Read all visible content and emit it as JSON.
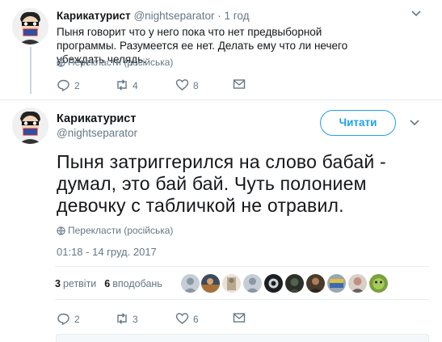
{
  "tweet_1": {
    "name": "Карикатурист",
    "handle": "@nightseparator",
    "dot": "·",
    "time": "1 год",
    "text": "Пыня говорит что у него пока что нет предвыборной программы. Разумеется ее нет. Делать ему что ли нечего убеждать челядь.",
    "translate": "Перекласти (російська)",
    "replies": "2",
    "retweets": "4",
    "likes": "8"
  },
  "tweet_2": {
    "name": "Карикатурист",
    "handle": "@nightseparator",
    "follow_label": "Читати",
    "text": "Пыня затриггерился на слово бабай - думал, это бай бай. Чуть полонием девочку с табличкой не отравил.",
    "translate": "Перекласти (російська)",
    "timestamp": "01:18 - 14 груд. 2017",
    "retweet_count": "3",
    "retweet_label": "ретвіти",
    "like_count": "6",
    "like_label": "вподобань",
    "replies": "2",
    "retweets": "3",
    "likes": "6"
  },
  "colors": {
    "accent": "#1da1f2",
    "muted": "#657786",
    "border": "#e6ecf0"
  },
  "icons": [
    "reply-icon",
    "retweet-icon",
    "heart-icon",
    "envelope-icon",
    "globe-icon",
    "chevron-down-icon"
  ]
}
